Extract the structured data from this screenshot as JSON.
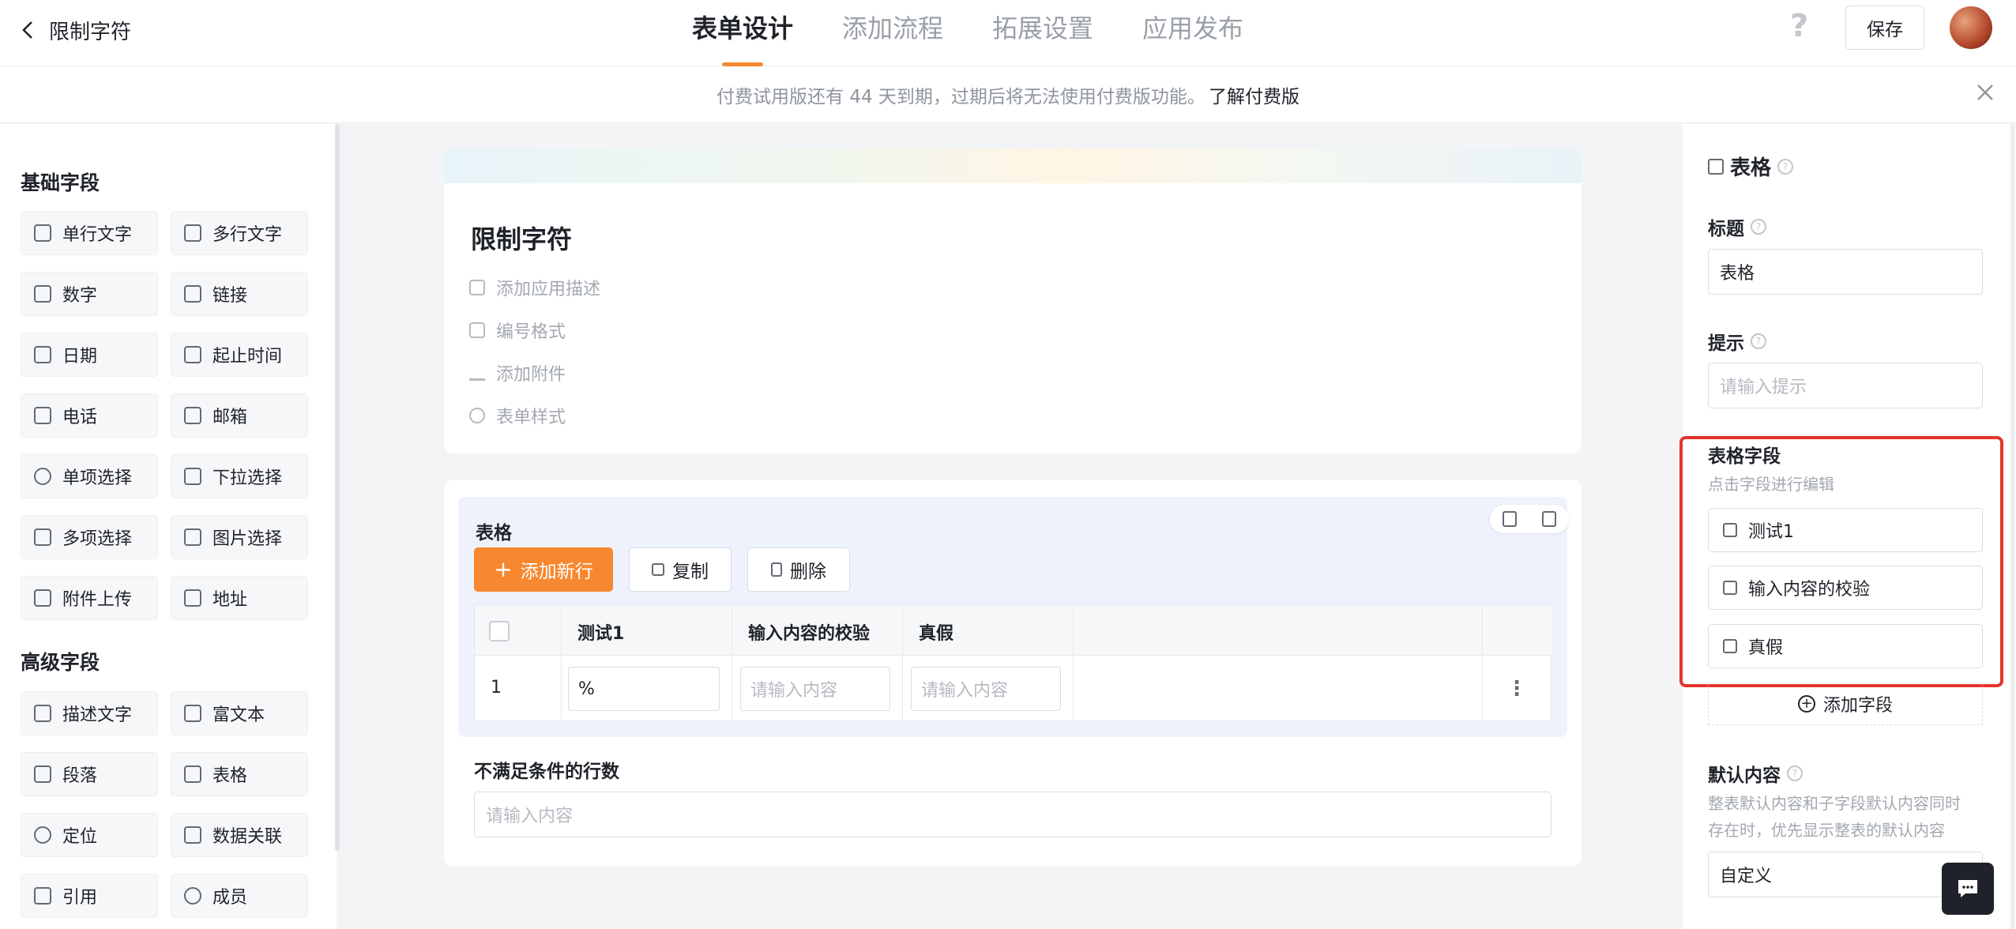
{
  "header": {
    "back_title": "限制字符",
    "tabs": [
      "表单设计",
      "添加流程",
      "拓展设置",
      "应用发布"
    ],
    "active_tab": 0,
    "help": "?",
    "save_label": "保存"
  },
  "banner": {
    "text": "付费试用版还有 44 天到期，过期后将无法使用付费版功能。",
    "link": "了解付费版"
  },
  "sidebar": {
    "basic_title": "基础字段",
    "basic_fields": [
      "单行文字",
      "多行文字",
      "数字",
      "链接",
      "日期",
      "起止时间",
      "电话",
      "邮箱",
      "单项选择",
      "下拉选择",
      "多项选择",
      "图片选择",
      "附件上传",
      "地址"
    ],
    "advanced_title": "高级字段",
    "advanced_fields": [
      "描述文字",
      "富文本",
      "段落",
      "表格",
      "定位",
      "数据关联",
      "引用",
      "成员"
    ]
  },
  "form": {
    "title": "限制字符",
    "options": [
      "添加应用描述",
      "编号格式",
      "添加附件",
      "表单样式"
    ]
  },
  "table_block": {
    "title": "表格",
    "add_row": "添加新行",
    "copy": "复制",
    "delete": "删除",
    "columns": [
      "测试1",
      "输入内容的校验",
      "真假"
    ],
    "row_index": "1",
    "row_values": [
      "%",
      "",
      ""
    ],
    "placeholder": "请输入内容"
  },
  "rows_field": {
    "label": "不满足条件的行数",
    "placeholder": "请输入内容"
  },
  "panel": {
    "type_title": "表格",
    "title_label": "标题",
    "title_value": "表格",
    "hint_label": "提示",
    "hint_placeholder": "请输入提示",
    "fields_label": "表格字段",
    "fields_hint": "点击字段进行编辑",
    "fields": [
      "测试1",
      "输入内容的校验",
      "真假"
    ],
    "add_field": "添加字段",
    "default_label": "默认内容",
    "default_hint_1": "整表默认内容和子字段默认内容同时",
    "default_hint_2": "存在时，优先显示整表的默认内容",
    "default_value": "自定义"
  },
  "colors": {
    "accent": "#f7882f",
    "highlight": "#e5342b"
  }
}
